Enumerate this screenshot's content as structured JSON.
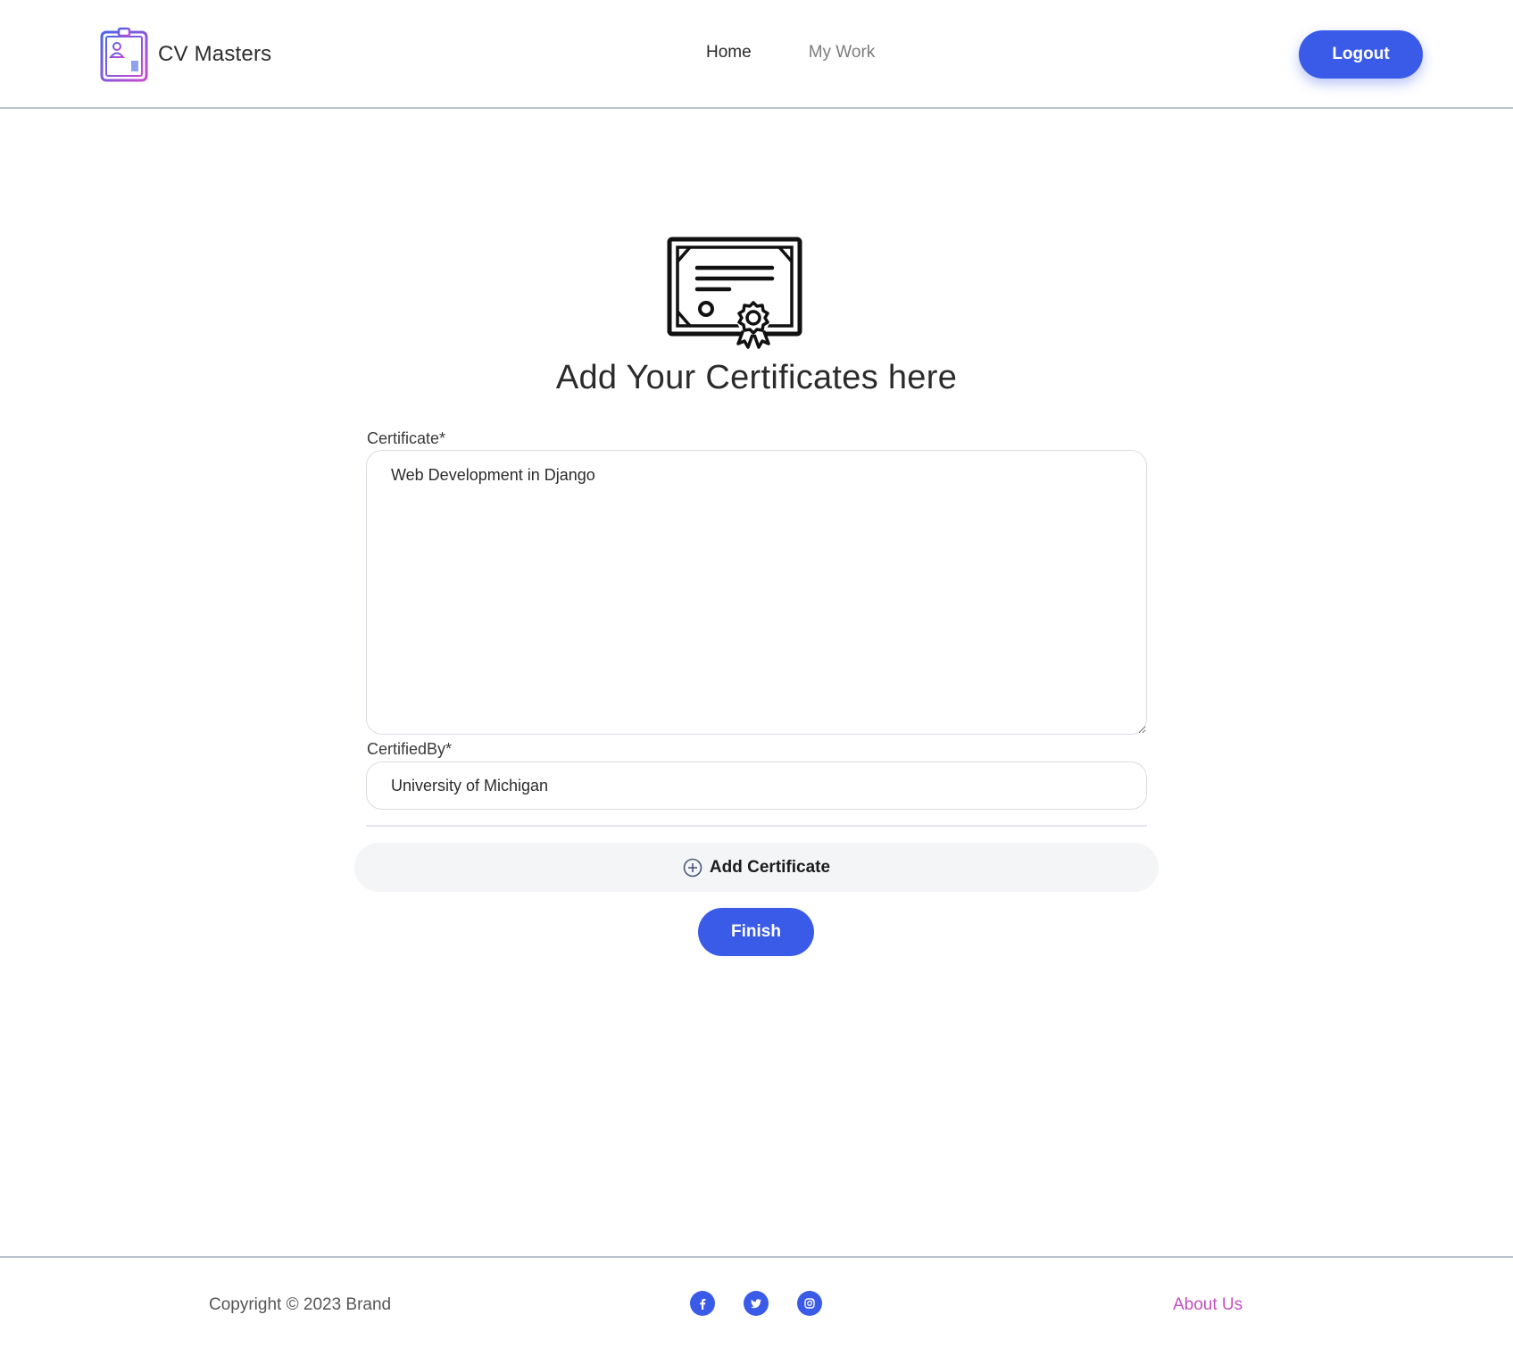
{
  "header": {
    "brand_name": "CV Masters",
    "nav": {
      "home": "Home",
      "my_work": "My Work"
    },
    "logout_label": "Logout"
  },
  "main": {
    "title": "Add Your Certificates here",
    "certificate_label": "Certificate*",
    "certificate_value": "Web Development in Django",
    "certified_by_label": "CertifiedBy*",
    "certified_by_value": "University of Michigan",
    "add_certificate_label": "Add Certificate",
    "finish_label": "Finish"
  },
  "footer": {
    "copyright": "Copyright © 2023 Brand",
    "socials": [
      "facebook-icon",
      "twitter-icon",
      "instagram-icon"
    ],
    "about_label": "About Us"
  },
  "colors": {
    "accent": "#3a5ae8",
    "about_link": "#c24fc0",
    "border": "#b9c3cf"
  }
}
